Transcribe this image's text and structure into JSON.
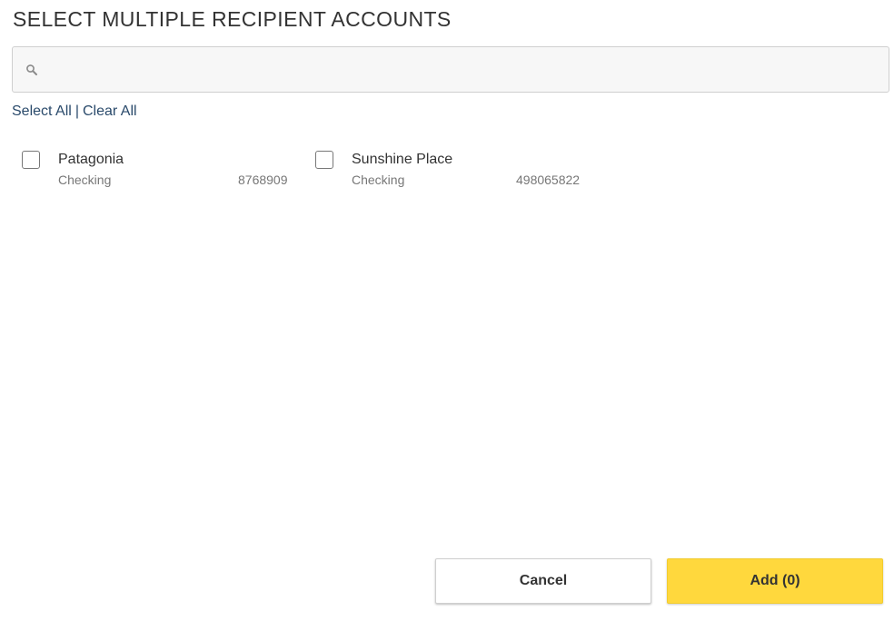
{
  "dialog": {
    "title": "SELECT MULTIPLE RECIPIENT ACCOUNTS"
  },
  "search": {
    "value": "",
    "placeholder": "",
    "icon": "search-icon"
  },
  "selection": {
    "select_all": "Select All",
    "separator": "|",
    "clear_all": "Clear All"
  },
  "accounts": [
    {
      "name": "Patagonia",
      "type": "Checking",
      "number": "8768909",
      "checked": false
    },
    {
      "name": "Sunshine Place",
      "type": "Checking",
      "number": "498065822",
      "checked": false
    }
  ],
  "buttons": {
    "cancel": "Cancel",
    "add": "Add (0)"
  },
  "colors": {
    "accent": "#ffd83d",
    "link": "#2a4a6b"
  }
}
